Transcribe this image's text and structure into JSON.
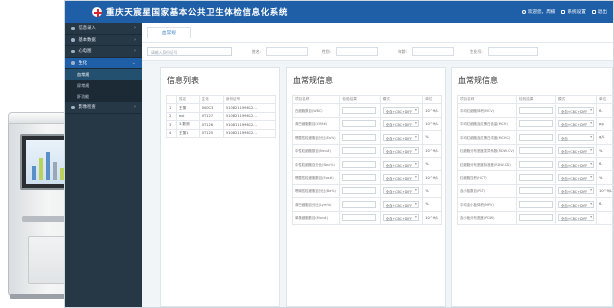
{
  "header": {
    "title": "重庆天宸星国家基本公共卫生体检信息化系统",
    "welcome": "欢迎您，周楠",
    "settings": "系统设置",
    "logout": "退出"
  },
  "sidebar": {
    "items": [
      {
        "label": "信息录入"
      },
      {
        "label": "基本数据"
      },
      {
        "label": "心电图"
      },
      {
        "label": "生化"
      }
    ],
    "subitems": [
      {
        "label": "血常规"
      },
      {
        "label": "尿常规"
      },
      {
        "label": "肝功能"
      }
    ],
    "last": {
      "label": "影像检查"
    }
  },
  "topbar": {
    "tab": "血常规"
  },
  "filter": {
    "id_placeholder": "请输入身份证号",
    "label_a": "姓名:",
    "label_b": "性别:",
    "label_c": "年龄:",
    "label_d": "生化号:"
  },
  "info_panel": {
    "title": "信息列表",
    "columns": [
      "",
      "姓名",
      "生化",
      "身份证号"
    ],
    "rows": [
      {
        "no": "1",
        "name": "王丽",
        "code": "000C3",
        "id": "510821199612..."
      },
      {
        "no": "2",
        "name": "eol",
        "code": "0T127",
        "id": "510821199612..."
      },
      {
        "no": "3",
        "name": "3.数测",
        "code": "0T126",
        "id": "510811199612..."
      },
      {
        "no": "4",
        "name": "王丽1",
        "code": "0T125",
        "id": "510821199612..."
      }
    ]
  },
  "blood_left": {
    "title": "血常规信息",
    "columns": [
      "项目名称",
      "检验结果",
      "模式",
      "单位"
    ],
    "rows": [
      {
        "name": "白细胞数目(WBC)",
        "mode": "全血+CBC+DIFF",
        "unit": "10^9/L"
      },
      {
        "name": "淋巴细胞数目(LYM#)",
        "mode": "全血+CBC+DIFF",
        "unit": "10^9/L"
      },
      {
        "name": "嗜酸性粒细胞百分比(Eo%)",
        "mode": "全血+CBC+DIFF",
        "unit": "%"
      },
      {
        "name": "中性粒细胞数目(Neu#)",
        "mode": "全血+CBC+DIFF",
        "unit": "10^9/L"
      },
      {
        "name": "中性粒细胞百分比(Neu%)",
        "mode": "全血+CBC+DIFF",
        "unit": "%"
      },
      {
        "name": "嗜酸性粒细胞数目(Eos#)",
        "mode": "全血+CBC+DIFF",
        "unit": "10^9/L"
      },
      {
        "name": "嗜碱性粒细胞百分比(Ba%)",
        "mode": "全血+CBC+DIFF",
        "unit": "%"
      },
      {
        "name": "淋巴细胞百分比(Lym%)",
        "mode": "全血+CBC+DIFF",
        "unit": "%"
      },
      {
        "name": "单核细胞数目(Mon#)",
        "mode": "全血+CBC+DIFF",
        "unit": "10^9/L"
      }
    ]
  },
  "blood_right": {
    "title": "血常规信息",
    "columns": [
      "项目名称",
      "检验结果",
      "模式",
      "单位"
    ],
    "rows": [
      {
        "name": "平均红细胞体积(MCV)",
        "mode": "全血+CBC+DIFF",
        "unit": "fL"
      },
      {
        "name": "平均红细胞血红蛋白含量(MCH)",
        "mode": "全血+CBC+DIFF",
        "unit": "pg"
      },
      {
        "name": "平均红细胞血红蛋白浓度(MCHC)",
        "mode": "全血",
        "unit": "g/L"
      },
      {
        "name": "红细胞分布宽度变异系数(RDW-CV)",
        "mode": "全血+CBC+DIFF",
        "unit": "%"
      },
      {
        "name": "红细胞分布宽度标准差(RDW-SD)",
        "mode": "全血+CBC+DIFF",
        "unit": "fL"
      },
      {
        "name": "红细胞压积(HCT)",
        "mode": "全血+CBC+DIFF",
        "unit": "%"
      },
      {
        "name": "血小板数目(PLT)",
        "mode": "全血+CBC+DIFF",
        "unit": "10^9/L"
      },
      {
        "name": "平均血小板体积(MPV)",
        "mode": "全血+CBC+DIFF",
        "unit": "fL"
      },
      {
        "name": "血小板分布宽度(PDW)",
        "mode": "全血+CBC+DIFF",
        "unit": ""
      }
    ]
  }
}
